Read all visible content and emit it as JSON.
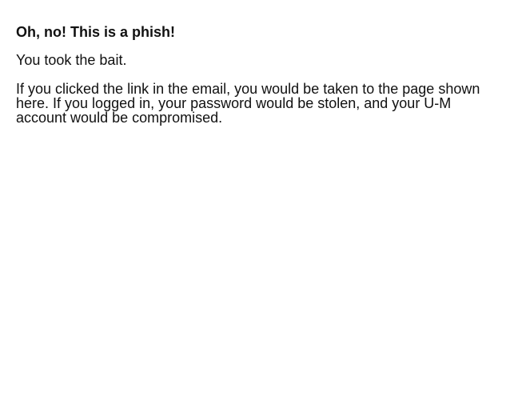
{
  "message": {
    "title": "Oh, no! This is a phish!",
    "line1": "You took the bait.",
    "line2": "If you clicked the link in the email, you would be taken to the page shown here. If you logged in, your password would be stolen, and your U-M account would be compromised."
  }
}
